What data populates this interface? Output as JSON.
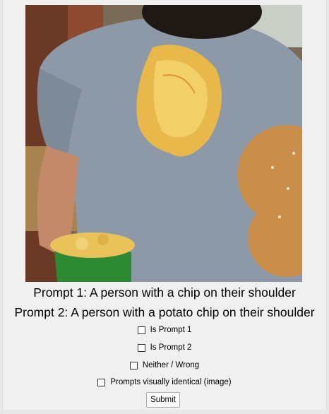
{
  "image": {
    "description_icon": "photo"
  },
  "prompts": {
    "prompt1": "Prompt 1: A person with a chip on their shoulder",
    "prompt2": "Prompt 2: A person with a potato chip on their shoulder"
  },
  "options": {
    "is_prompt_1": "Is Prompt 1",
    "is_prompt_2": "Is Prompt 2",
    "neither": "Neither / Wrong",
    "identical": "Prompts visually identical (image)"
  },
  "actions": {
    "submit": "Submit"
  }
}
